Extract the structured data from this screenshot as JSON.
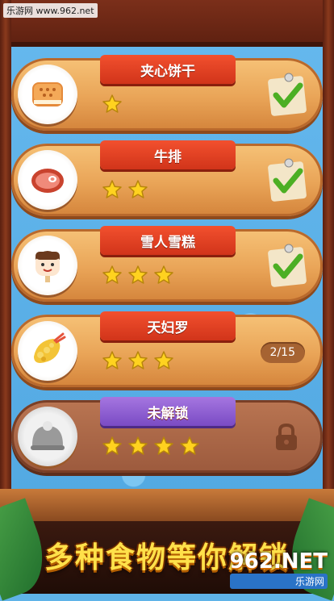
{
  "watermark": "乐游网 www.962.net",
  "levels": [
    {
      "name": "夹心饼干",
      "stars": 1,
      "status": "complete",
      "food_icon": "sandwich-cookie-icon"
    },
    {
      "name": "牛排",
      "stars": 2,
      "status": "complete",
      "food_icon": "steak-icon"
    },
    {
      "name": "雪人雪糕",
      "stars": 3,
      "status": "complete",
      "food_icon": "snowman-popsicle-icon"
    },
    {
      "name": "天妇罗",
      "stars": 3,
      "status": "in-progress",
      "progress": "2/15",
      "food_icon": "tempura-icon"
    },
    {
      "name": "未解锁",
      "stars": 4,
      "status": "locked",
      "food_icon": "covered-dish-icon"
    }
  ],
  "slogan": "多种食物等你解锁",
  "logo": {
    "big": "962.NET",
    "small": "乐游网"
  },
  "colors": {
    "ribbon": "#e5401f",
    "locked_ribbon": "#8f5fd2",
    "card": "#eaa75a",
    "star": "#ffd21f",
    "check": "#4caf24"
  }
}
